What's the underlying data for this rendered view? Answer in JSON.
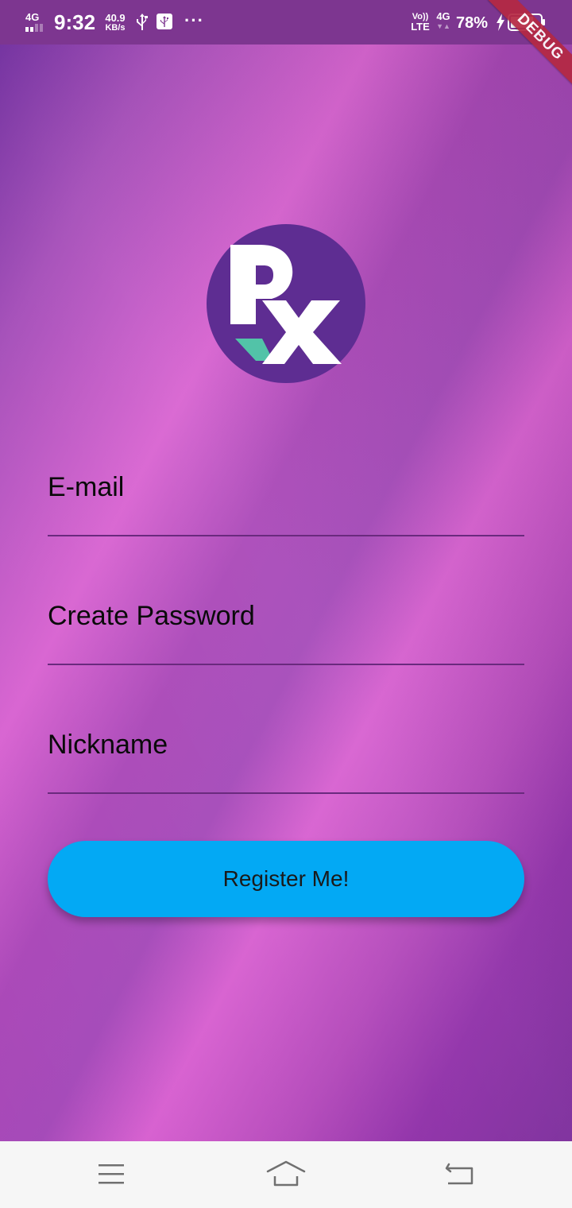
{
  "status_bar": {
    "network_left": "4G",
    "time": "9:32",
    "speed_value": "40.9",
    "speed_unit": "KB/s",
    "more": "···",
    "volte_top": "Vo))",
    "volte_bottom": "LTE",
    "network_right": "4G",
    "battery_percent": "78%"
  },
  "debug_banner": "DEBUG",
  "form": {
    "email_label": "E-mail",
    "password_label": "Create Password",
    "nickname_label": "Nickname",
    "register_label": "Register Me!"
  },
  "colors": {
    "status_bar": "#7d3690",
    "gradient_dark": "#6e2a9c",
    "gradient_light": "#d863d1",
    "logo_circle": "#5e2d92",
    "logo_accent": "#52c3a8",
    "button": "#03a9f4",
    "underline": "#6a2a7e",
    "debug_banner": "#b52842",
    "nav_bar": "#f6f6f6"
  },
  "icons": {
    "usb": "usb-icon",
    "debug": "usb-debug-icon",
    "charging": "charging-bolt-icon",
    "battery": "battery-icon",
    "menu": "menu-icon",
    "home": "home-icon",
    "back": "back-icon"
  },
  "battery_level": 0.78
}
